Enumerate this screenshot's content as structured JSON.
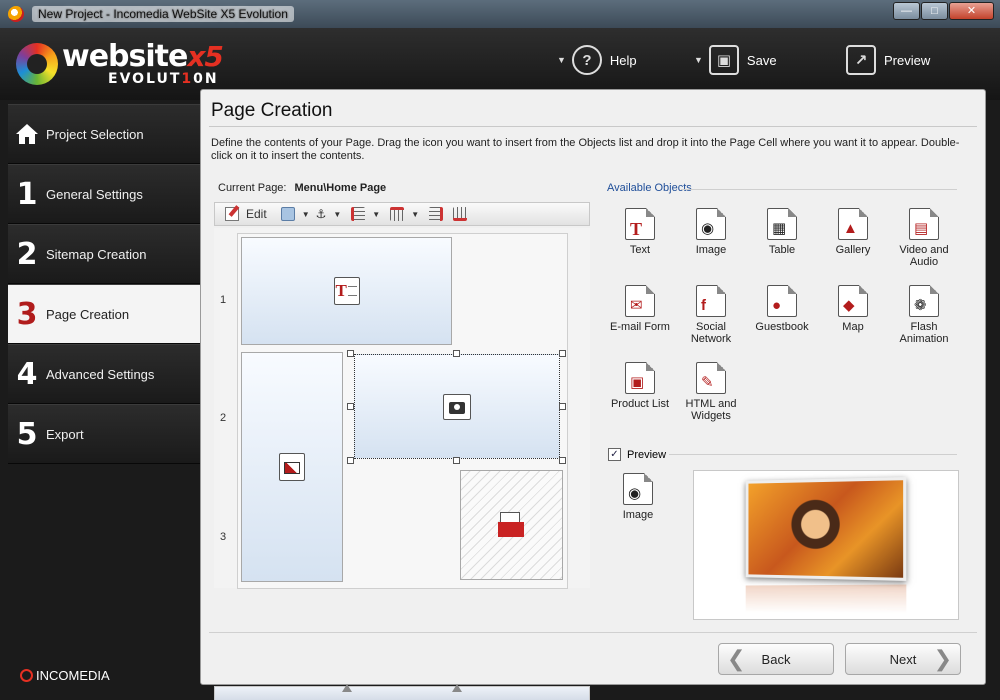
{
  "window": {
    "title": "New Project - Incomedia WebSite X5 Evolution"
  },
  "logo": {
    "main": "website",
    "x5": "x5",
    "sub_a": "EVOLUT",
    "sub_b": "1",
    "sub_c": "0N"
  },
  "toolbar": {
    "help": "Help",
    "save": "Save",
    "preview": "Preview"
  },
  "steps": [
    {
      "num": "",
      "label": "Project Selection"
    },
    {
      "num": "1",
      "label": "General Settings"
    },
    {
      "num": "2",
      "label": "Sitemap Creation"
    },
    {
      "num": "3",
      "label": "Page Creation"
    },
    {
      "num": "4",
      "label": "Advanced Settings"
    },
    {
      "num": "5",
      "label": "Export"
    }
  ],
  "brand": "INCOMEDIA",
  "main": {
    "title": "Page Creation",
    "description": "Define the contents of your Page. Drag the icon you want to insert from the Objects list and drop it into the Page Cell where you want it to appear. Double-click on it to insert the contents.",
    "current_label": "Current Page:",
    "current_value": "Menu\\Home Page",
    "edit_label": "Edit",
    "rows": [
      "1",
      "2",
      "3"
    ],
    "available_label": "Available Objects",
    "objects": [
      {
        "label": "Text",
        "icon": "text-icon"
      },
      {
        "label": "Image",
        "icon": "image-icon"
      },
      {
        "label": "Table",
        "icon": "table-icon"
      },
      {
        "label": "Gallery",
        "icon": "gallery-icon"
      },
      {
        "label": "Video and Audio",
        "icon": "video-icon"
      },
      {
        "label": "E-mail Form",
        "icon": "email-icon"
      },
      {
        "label": "Social Network",
        "icon": "social-icon"
      },
      {
        "label": "Guestbook",
        "icon": "guestbook-icon"
      },
      {
        "label": "Map",
        "icon": "map-icon"
      },
      {
        "label": "Flash Animation",
        "icon": "flash-icon"
      },
      {
        "label": "Product List",
        "icon": "cart-icon"
      },
      {
        "label": "HTML and Widgets",
        "icon": "html-icon"
      }
    ],
    "preview_label": "Preview",
    "preview_checked": true,
    "preview_object": "Image",
    "back_label": "Back",
    "next_label": "Next"
  }
}
